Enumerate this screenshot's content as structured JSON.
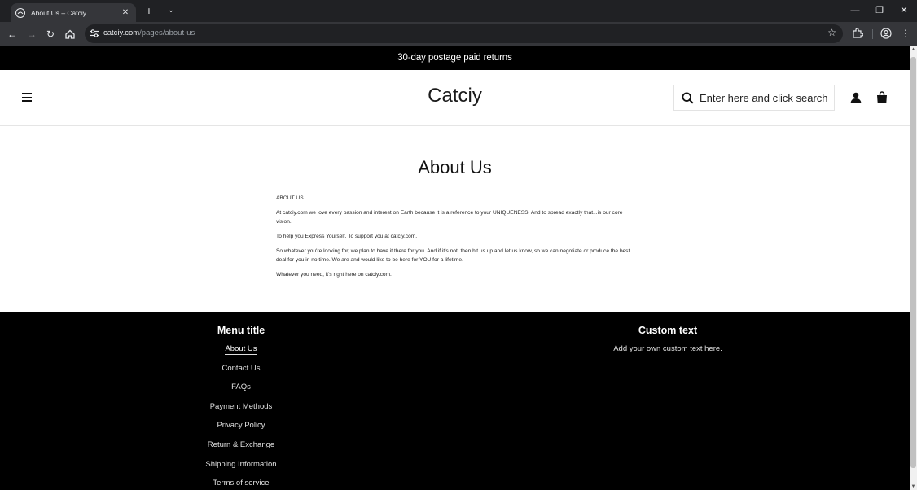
{
  "browser": {
    "tab_title": "About Us – Catciy",
    "url_domain": "catciy.com",
    "url_path": "/pages/about-us"
  },
  "announcement": "30-day postage paid returns",
  "header": {
    "logo": "Catciy",
    "search_placeholder": "Enter here and click search"
  },
  "page": {
    "title": "About Us",
    "paragraphs": [
      "ABOUT US",
      "At catciy.com  we love every passion and interest on Earth because it is a reference to your UNIQUENESS. And to spread exactly that...is our core vision.",
      "To help you Express Yourself. To support you at catciy.com.",
      "So whatever you're looking for, we plan to have it there for you. And if it's not, then hit us up and let us know, so we can negotiate or produce the best deal for you in no time. We are and would like to be here for YOU for a lifetime.",
      "Whatever you need, it's right here on catciy.com."
    ]
  },
  "footer": {
    "menu_title": "Menu title",
    "links": [
      "About Us",
      "Contact Us",
      "FAQs",
      "Payment Methods",
      "Privacy Policy",
      "Return & Exchange",
      "Shipping Information",
      "Terms of service"
    ],
    "custom_title": "Custom text",
    "custom_body": "Add your own custom text here."
  }
}
